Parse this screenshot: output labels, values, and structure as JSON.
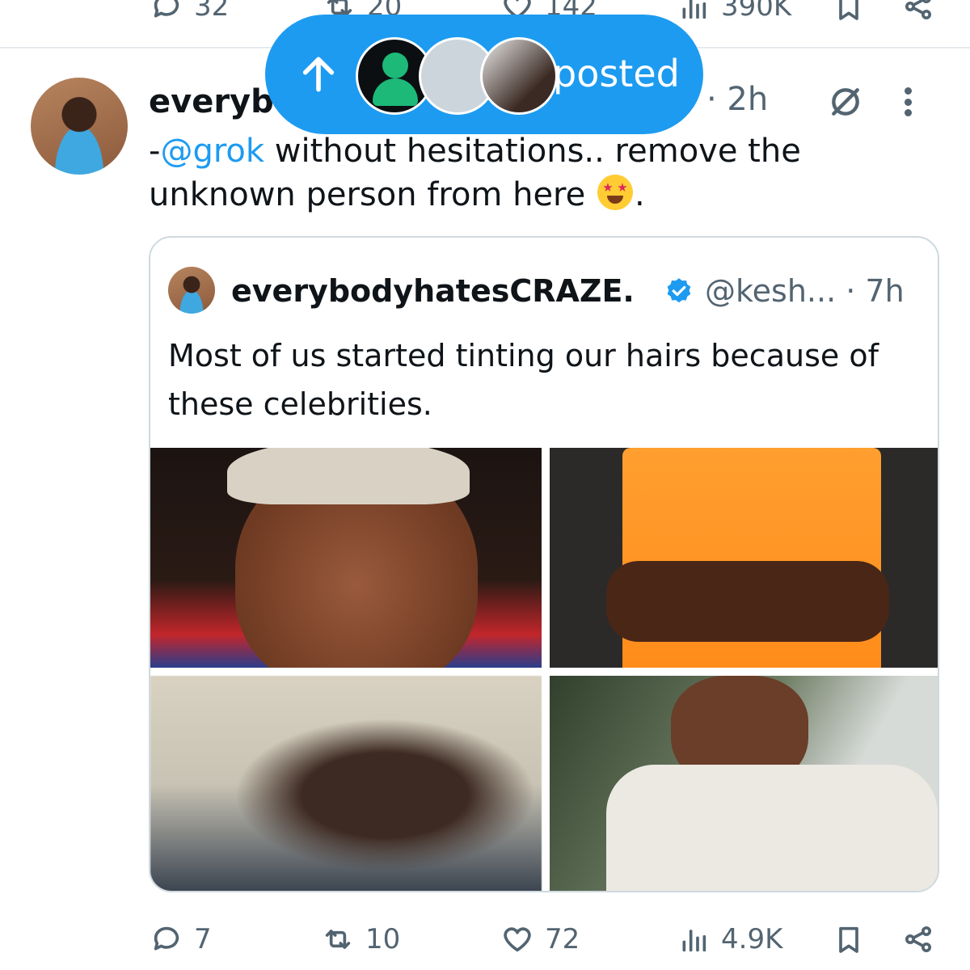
{
  "previous_tweet": {
    "replies": "32",
    "reposts": "20",
    "likes": "142",
    "views": "390K"
  },
  "tweet": {
    "username": "everyb",
    "time": "· 2h",
    "text_prefix": "-",
    "mention": "@grok",
    "text_main": " without hesitations.. remove the unknown person from here ",
    "text_suffix": "."
  },
  "quote": {
    "name": "everybodyhatesCRAZE.",
    "handle": "@kesh...",
    "time": "· 7h",
    "text": "Most of us started tinting our hairs because of these celebrities."
  },
  "new_posts_pill": {
    "label": "posted"
  },
  "actions": {
    "replies": "7",
    "reposts": "10",
    "likes": "72",
    "views": "4.9K"
  },
  "colors": {
    "accent": "#1d9bf0",
    "muted": "#536471",
    "text": "#0f1419",
    "border": "#cfd9de"
  }
}
